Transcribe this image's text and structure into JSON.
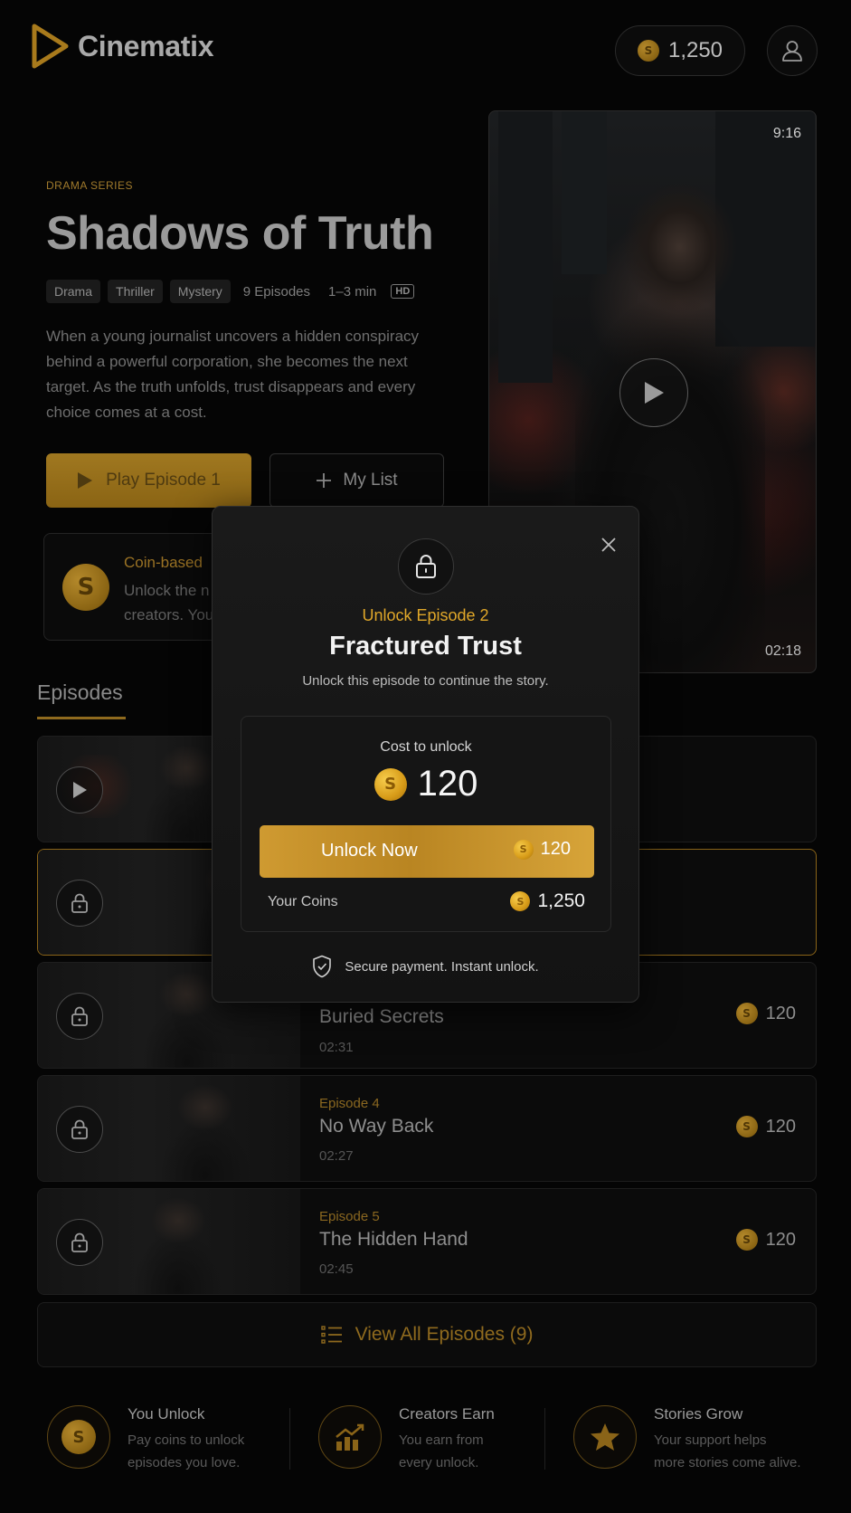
{
  "header": {
    "app_name": "Cinematix",
    "coin_balance": "1,250"
  },
  "hero": {
    "category": "DRAMA SERIES",
    "title": "Shadows of Truth",
    "tags": [
      "Drama",
      "Thriller",
      "Mystery"
    ],
    "episodes_count": "9 Episodes",
    "duration": "1–3 min",
    "quality": "HD",
    "description": "When a young journalist uncovers a hidden conspiracy behind a powerful corporation, she becomes the next target. As the truth unfolds, trust disappears and every choice comes at a cost.",
    "play_label": "Play Episode 1",
    "mylist_label": "My List",
    "info_title": "Coin-based",
    "info_line1": "Unlock the n",
    "info_line2": "creators. You"
  },
  "poster": {
    "aspect": "9:16",
    "duration": "02:18"
  },
  "episodes": {
    "heading": "Episodes",
    "rows": [
      {
        "number": "",
        "title": "",
        "duration": "",
        "price": "",
        "state": "playable"
      },
      {
        "number": "",
        "title": "",
        "duration": "",
        "price": "",
        "state": "locked-selected"
      },
      {
        "number": "",
        "title": "Buried Secrets",
        "duration": "02:31",
        "price": "120",
        "state": "locked"
      },
      {
        "number": "Episode 4",
        "title": "No Way Back",
        "duration": "02:27",
        "price": "120",
        "state": "locked"
      },
      {
        "number": "Episode 5",
        "title": "The Hidden Hand",
        "duration": "02:45",
        "price": "120",
        "state": "locked"
      }
    ],
    "view_all_label": "View All Episodes (9)"
  },
  "features": [
    {
      "title": "You Unlock",
      "line1": "Pay coins to unlock",
      "line2": "episodes you love.",
      "icon": "coin-icon"
    },
    {
      "title": "Creators Earn",
      "line1": "You earn from",
      "line2": "every unlock.",
      "icon": "growth-chart-icon"
    },
    {
      "title": "Stories Grow",
      "line1": "Your support helps",
      "line2": "more stories come alive.",
      "icon": "star-icon"
    }
  ],
  "modal": {
    "kicker": "Unlock Episode 2",
    "title": "Fractured Trust",
    "subtitle": "Unlock this episode to continue the story.",
    "cost_label": "Cost to unlock",
    "cost": "120",
    "unlock_label": "Unlock Now",
    "unlock_price": "120",
    "your_coins_label": "Your Coins",
    "your_coins_value": "1,250",
    "secure_text": "Secure payment. Instant unlock."
  },
  "colors": {
    "accent_gold": "#d79b18",
    "kicker_gold": "#e0a729",
    "background": "#050505"
  }
}
